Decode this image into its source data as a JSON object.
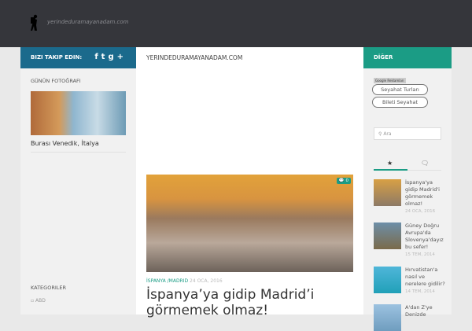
{
  "header": {
    "site_name": "yerindeduramayanadam.com"
  },
  "nav": {
    "follow_label": "BIZI TAKIP EDIN:",
    "social": [
      "f",
      "t",
      "g+"
    ],
    "site_title": "YERINDEDURAMAYANADAM.COM",
    "other_label": "DİĞER"
  },
  "left": {
    "photo_heading": "GÜNÜN FOTOĞRAFI",
    "photo_caption": "Burası Venedik, İtalya",
    "categories_heading": "KATEGORILER",
    "categories": [
      "ABD"
    ]
  },
  "main": {
    "comment_count": "0",
    "categories": [
      "İSPANYA",
      "MADRID"
    ],
    "date": "24 OCA, 2016",
    "title": "İspanya’ya gidip Madrid’i görmemek olmaz!"
  },
  "right": {
    "ad_label": "Google Reklamları",
    "ad_links": [
      "Seyahat Turları",
      "Bileti Seyahat"
    ],
    "search_placeholder": "Ara",
    "posts": [
      {
        "title": "İspanya'ya gidip Madrid'i görmemek olmaz!",
        "date": "24 OCA, 2016"
      },
      {
        "title": "Güney Doğru Avrupa'da Slovenya'dayız bu sefer!",
        "date": "15 TEM, 2014"
      },
      {
        "title": "Hırvatistan'a nasıl ve nerelere gidilir?",
        "date": "14 TEM, 2014"
      },
      {
        "title": "A'dan Z'ye Denizde",
        "date": ""
      }
    ]
  },
  "colors": {
    "blue": "#1b6a8c",
    "teal": "#1b9c85",
    "dark": "#35363b"
  }
}
